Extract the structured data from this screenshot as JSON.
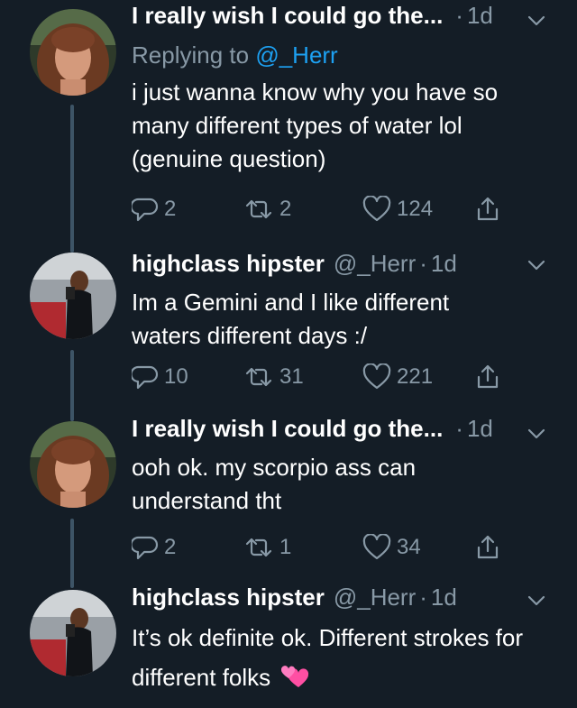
{
  "colors": {
    "background": "#141d26",
    "primary_text": "#ffffff",
    "secondary_text": "#8899a6",
    "link": "#1da1f2",
    "thread_line": "#3d5466",
    "heart_emoji": "#ff4fa3"
  },
  "tweets": [
    {
      "name": "I really wish I could go the...",
      "handle": "",
      "dot": "·",
      "time": "1d",
      "replying_label": "Replying to",
      "replying_mention": "@_Herr",
      "text": "i just wanna know why you have so many different types of water lol (genuine question)",
      "replies": "2",
      "retweets": "2",
      "likes": "124",
      "avatar_icon": "avatar-girl-selfie"
    },
    {
      "name": "highclass hipster",
      "handle": "@_Herr",
      "dot": "·",
      "time": "1d",
      "text": "Im a Gemini and I like different waters different days :/",
      "replies": "10",
      "retweets": "31",
      "likes": "221",
      "avatar_icon": "avatar-mirror-selfie"
    },
    {
      "name": "I really wish I could go the...",
      "handle": "",
      "dot": "·",
      "time": "1d",
      "text": "ooh ok. my scorpio ass can understand tht",
      "replies": "2",
      "retweets": "1",
      "likes": "34",
      "avatar_icon": "avatar-girl-selfie"
    },
    {
      "name": "highclass hipster",
      "handle": "@_Herr",
      "dot": "·",
      "time": "1d",
      "text": "It’s ok definite ok. Different strokes for different folks",
      "emoji": "two-hearts-emoji",
      "avatar_icon": "avatar-mirror-selfie"
    }
  ]
}
